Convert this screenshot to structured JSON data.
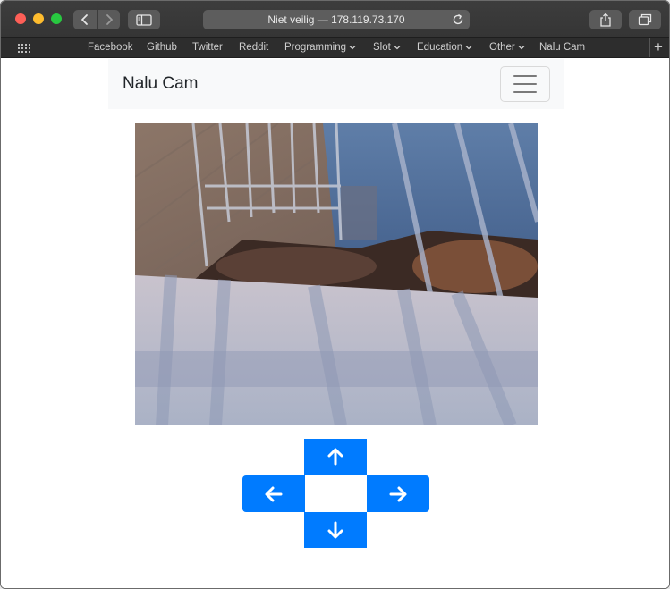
{
  "browser": {
    "address": "Niet veilig — 178.119.73.170",
    "favorites": [
      {
        "label": "Facebook",
        "menu": false
      },
      {
        "label": "Github",
        "menu": false
      },
      {
        "label": "Twitter",
        "menu": false
      },
      {
        "label": "Reddit",
        "menu": false
      },
      {
        "label": "Programming",
        "menu": true
      },
      {
        "label": "Slot",
        "menu": true
      },
      {
        "label": "Education",
        "menu": true
      },
      {
        "label": "Other",
        "menu": true
      },
      {
        "label": "Nalu Cam",
        "menu": false
      }
    ]
  },
  "page": {
    "brand": "Nalu Cam"
  },
  "controls": {
    "up": "arrow-up-icon",
    "down": "arrow-down-icon",
    "left": "arrow-left-icon",
    "right": "arrow-right-icon",
    "accent": "#007bff"
  }
}
